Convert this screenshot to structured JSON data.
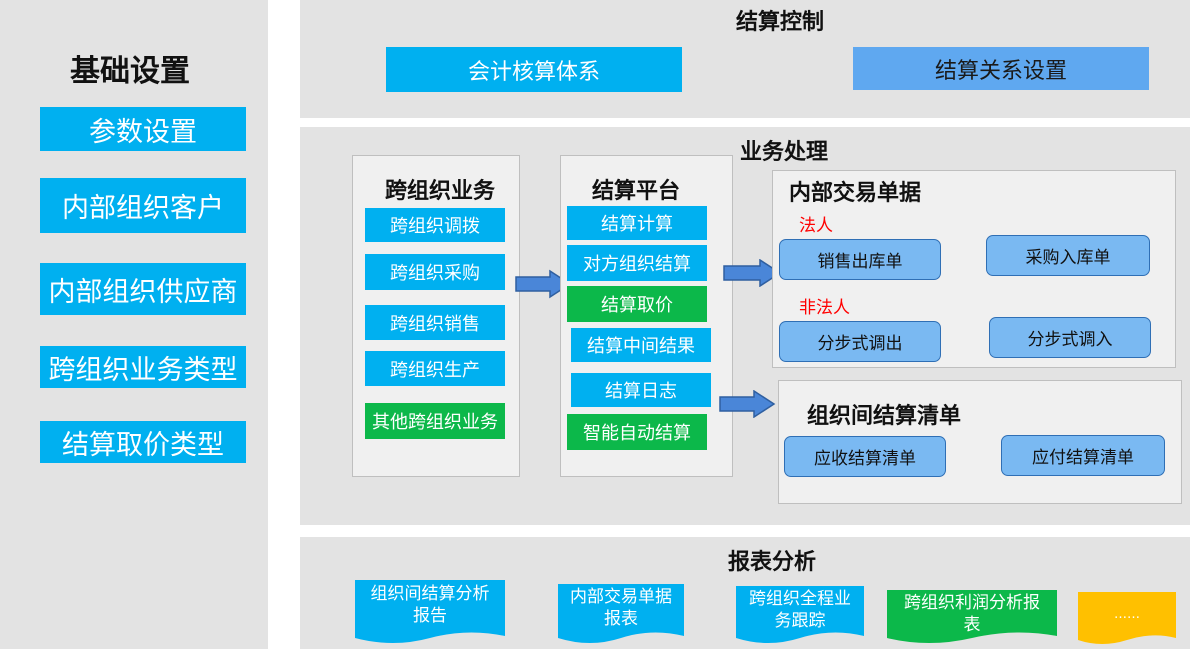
{
  "left": {
    "title": "基础设置",
    "items": [
      "参数设置",
      "内部组织客户",
      "内部组织供应商",
      "跨组织业务类型",
      "结算取价类型"
    ]
  },
  "settlement_control": {
    "title": "结算控制",
    "btn1": "会计核算体系",
    "btn2": "结算关系设置"
  },
  "business": {
    "title": "业务处理",
    "cross_org": {
      "title": "跨组织业务",
      "items": [
        "跨组织调拨",
        "跨组织采购",
        "跨组织销售",
        "跨组织生产",
        "其他跨组织业务"
      ]
    },
    "platform": {
      "title": "结算平台",
      "items": [
        "结算计算",
        "对方组织结算",
        "结算取价",
        "结算中间结果",
        "结算日志",
        "智能自动结算"
      ]
    },
    "internal_docs": {
      "title": "内部交易单据",
      "legal_label": "法人",
      "non_legal_label": "非法人",
      "items": [
        "销售出库单",
        "采购入库单",
        "分步式调出",
        "分步式调入"
      ]
    },
    "settle_list": {
      "title": "组织间结算清单",
      "items": [
        "应收结算清单",
        "应付结算清单"
      ]
    }
  },
  "reports": {
    "title": "报表分析",
    "items": [
      "组织间结算分析\n报告",
      "内部交易单据\n报表",
      "跨组织全程业\n务跟踪",
      "跨组织利润分析报\n表",
      "……"
    ]
  },
  "colors": {
    "cyan": "#00b0f0",
    "light_blue": "#5fa8f0",
    "green": "#0cb84a",
    "yellow": "#ffc000",
    "panel": "#e3e3e3",
    "arrow": "#4a86d8"
  }
}
